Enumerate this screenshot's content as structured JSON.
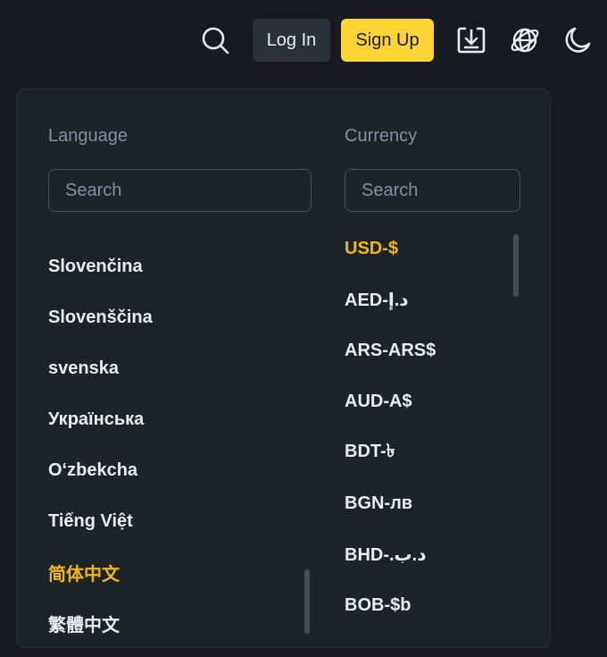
{
  "header": {
    "login_label": "Log In",
    "signup_label": "Sign Up",
    "icons": [
      "search-icon",
      "download-icon",
      "globe-icon",
      "moon-icon"
    ]
  },
  "panel": {
    "language": {
      "title": "Language",
      "search_placeholder": "Search",
      "items": [
        "Slovenčina",
        "Slovenščina",
        "svenska",
        "Українська",
        "O‘zbekcha",
        "Tiếng Việt",
        "简体中文",
        "繁體中文"
      ],
      "selected": "简体中文"
    },
    "currency": {
      "title": "Currency",
      "search_placeholder": "Search",
      "items": [
        "USD-$",
        "AED-د.إ",
        "ARS-ARS$",
        "AUD-A$",
        "BDT-৳",
        "BGN-лв",
        "BHD-.د.ب",
        "BOB-$b"
      ],
      "selected": "USD-$"
    }
  },
  "colors": {
    "background": "#181a20",
    "panel": "#1e2329",
    "accent": "#fcd535",
    "selected_text": "#f0b90b",
    "muted_text": "#848e9c",
    "button_dark": "#2b3139"
  }
}
